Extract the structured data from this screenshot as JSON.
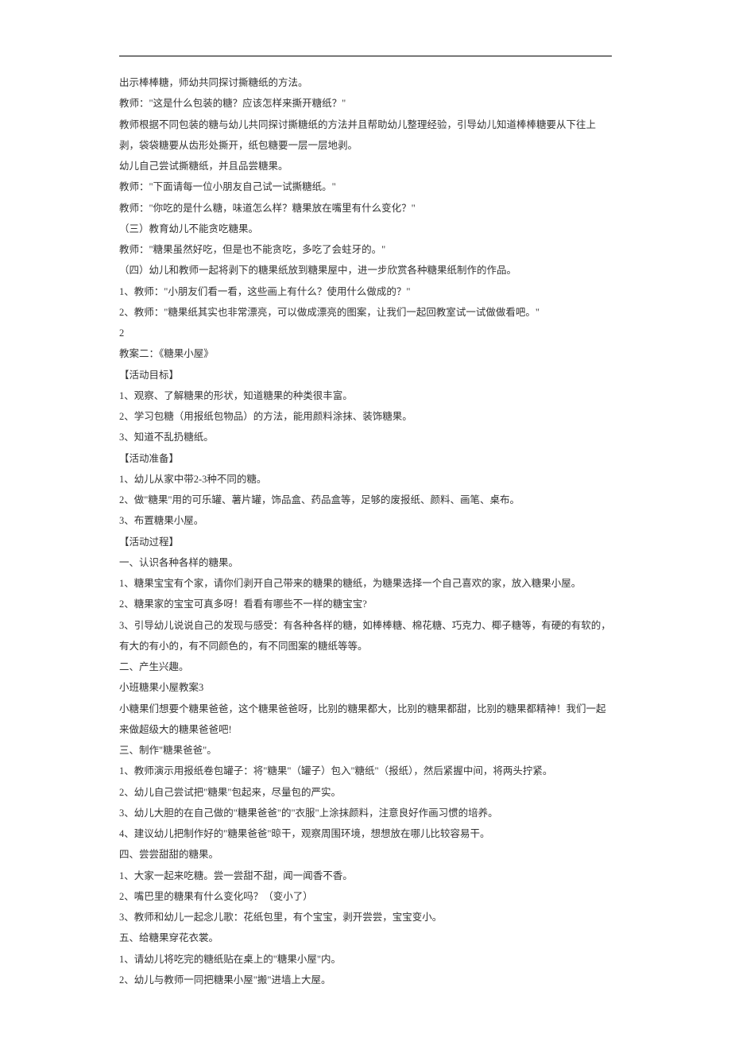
{
  "lines": [
    "出示棒棒糖，师幼共同探讨撕糖纸的方法。",
    "教师：\"这是什么包装的糖？应该怎样来撕开糖纸？\"",
    "教师根据不同包装的糖与幼儿共同探讨撕糖纸的方法并且帮助幼儿整理经验，引导幼儿知道棒棒糖要从下往上剥，袋袋糖要从齿形处撕开，纸包糖要一层一层地剥。",
    "幼儿自己尝试撕糖纸，并且品尝糖果。",
    "教师：\"下面请每一位小朋友自己试一试撕糖纸。\"",
    "教师：\"你吃的是什么糖，味道怎么样？糖果放在嘴里有什么变化？\"",
    "（三）教育幼儿不能贪吃糖果。",
    "教师：\"糖果虽然好吃，但是也不能贪吃，多吃了会蛀牙的。\"",
    "（四）幼儿和教师一起将剥下的糖果纸放到糖果屋中，进一步欣赏各种糖果纸制作的作品。",
    "1、教师：\"小朋友们看一看，这些画上有什么？使用什么做成的？\"",
    "2、教师：\"糖果纸其实也非常漂亮，可以做成漂亮的图案，让我们一起回教室试一试做做看吧。\"",
    "2",
    "教案二：《糖果小屋》",
    "【活动目标】",
    "1、观察、了解糖果的形状，知道糖果的种类很丰富。",
    "2、学习包糖（用报纸包物品）的方法，能用颜料涂抹、装饰糖果。",
    "3、知道不乱扔糖纸。",
    "【活动准备】",
    "1、幼儿从家中带2-3种不同的糖。",
    "2、做\"糖果\"用的可乐罐、薯片罐，饰品盒、药品盒等，足够的废报纸、颜料、画笔、桌布。",
    "3、布置糖果小屋。",
    "【活动过程】",
    "一、认识各种各样的糖果。",
    "1、糖果宝宝有个家，请你们剥开自己带来的糖果的糖纸，为糖果选择一个自己喜欢的家，放入糖果小屋。",
    "2、糖果家的宝宝可真多呀！看看有哪些不一样的糖宝宝?",
    "3、引导幼儿说说自己的发现与感受：有各种各样的糖，如棒棒糖、棉花糖、巧克力、椰子糖等，有硬的有软的，有大的有小的，有不同颜色的，有不同图案的糖纸等等。",
    "二、产生兴趣。",
    "小班糖果小屋教案3",
    "小糖果们想要个糖果爸爸，这个糖果爸爸呀，比别的糖果都大，比别的糖果都甜，比别的糖果都精神！我们一起来做超级大的糖果爸爸吧!",
    "三、制作\"糖果爸爸\"。",
    "1、教师演示用报纸卷包罐子：将\"糖果\"（罐子）包入\"糖纸\"（报纸），然后紧握中间，将两头拧紧。",
    "2、幼儿自己尝试把\"糖果\"包起来，尽量包的严实。",
    "3、幼儿大胆的在自己做的\"糖果爸爸\"的\"衣服\"上涂抹颜料，注意良好作画习惯的培养。",
    "4、建议幼儿把制作好的\"糖果爸爸\"晾干，观察周围环境，想想放在哪儿比较容易干。",
    "四、尝尝甜甜的糖果。",
    "1、大家一起来吃糖。尝一尝甜不甜，闻一闻香不香。",
    "2、嘴巴里的糖果有什么变化吗？（变小了）",
    "3、教师和幼儿一起念儿歌：花纸包里，有个宝宝，剥开尝尝，宝宝变小。",
    "五、给糖果穿花衣裳。",
    "1、请幼儿将吃完的糖纸贴在桌上的\"糖果小屋\"内。",
    "2、幼儿与教师一同把糖果小屋\"搬\"进墙上大屋。"
  ]
}
